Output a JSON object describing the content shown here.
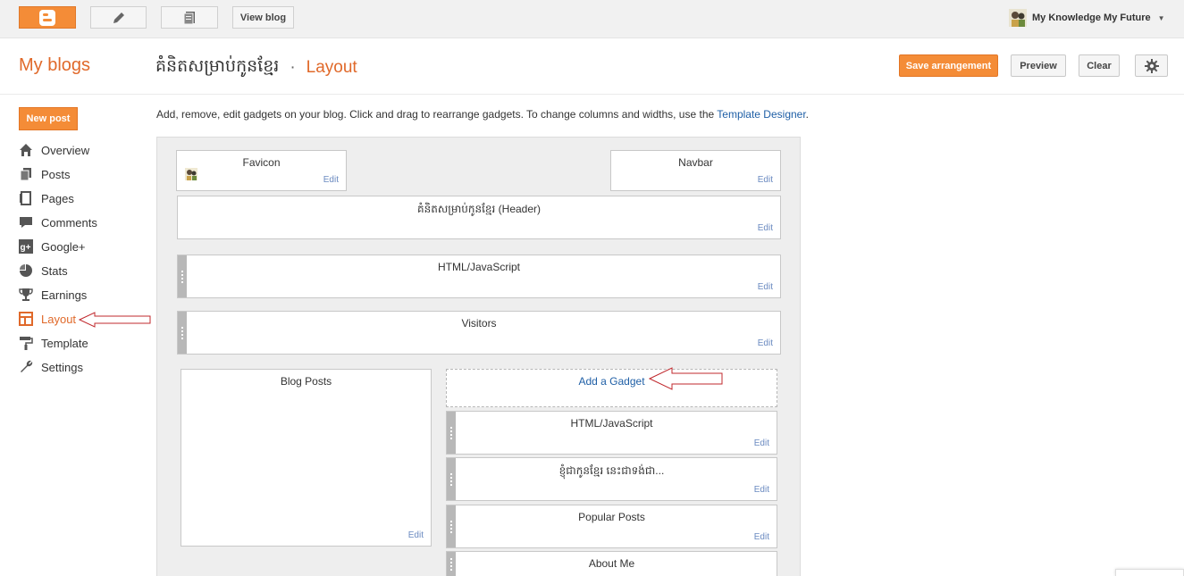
{
  "topbar": {
    "view_blog": "View blog",
    "account_name": "My Knowledge My Future"
  },
  "header": {
    "my_blogs": "My blogs",
    "blog_title": "គំនិតសម្រាប់កូនខ្មែរ",
    "separator": "·",
    "section": "Layout",
    "save": "Save arrangement",
    "preview": "Preview",
    "clear": "Clear"
  },
  "sidebar": {
    "new_post": "New post",
    "items": [
      {
        "label": "Overview",
        "icon": "home-icon"
      },
      {
        "label": "Posts",
        "icon": "posts-icon"
      },
      {
        "label": "Pages",
        "icon": "pages-icon"
      },
      {
        "label": "Comments",
        "icon": "comments-icon"
      },
      {
        "label": "Google+",
        "icon": "google-plus-icon"
      },
      {
        "label": "Stats",
        "icon": "stats-icon"
      },
      {
        "label": "Earnings",
        "icon": "trophy-icon"
      },
      {
        "label": "Layout",
        "icon": "layout-icon",
        "active": true
      },
      {
        "label": "Template",
        "icon": "paint-roller-icon"
      },
      {
        "label": "Settings",
        "icon": "wrench-icon"
      }
    ]
  },
  "main": {
    "instruction": "Add, remove, edit gadgets on your blog. Click and drag to rearrange gadgets. To change columns and widths, use the ",
    "template_designer": "Template Designer",
    "instruction_end": ".",
    "edit": "Edit",
    "gadgets": {
      "favicon": "Favicon",
      "navbar": "Navbar",
      "header": "គំនិតសម្រាប់កូនខ្មែរ (Header)",
      "html1": "HTML/JavaScript",
      "visitors": "Visitors",
      "blog_posts": "Blog Posts",
      "add_gadget": "Add a Gadget",
      "html2": "HTML/JavaScript",
      "khmer": "ខ្ញុំជាកូនខ្មែរ នេះជាទង់ជា...",
      "popular": "Popular Posts",
      "about": "About Me"
    }
  },
  "colors": {
    "accent": "#f48c37",
    "link": "#1f5fa6",
    "arrow": "#c0282d"
  }
}
